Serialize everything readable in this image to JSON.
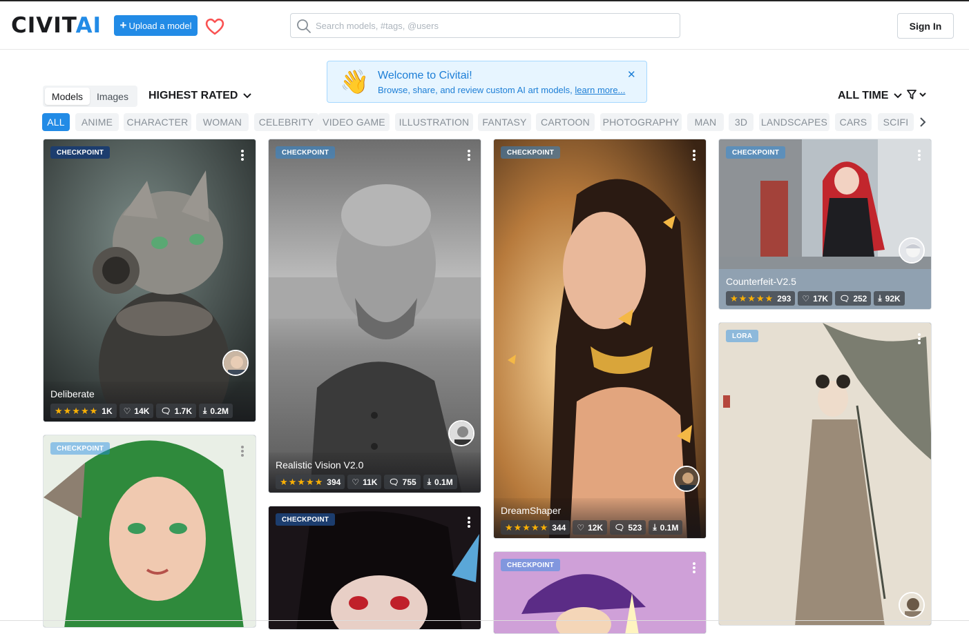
{
  "header": {
    "logo_main": "CIVIT",
    "logo_accent": "AI",
    "upload_label": "Upload a model",
    "search_placeholder": "Search models, #tags, @users",
    "signin_label": "Sign In"
  },
  "welcome": {
    "title": "Welcome to Civitai!",
    "body": "Browse, share, and review custom AI art models,",
    "link": "learn more..."
  },
  "toolbar": {
    "tab_models": "Models",
    "tab_images": "Images",
    "sort_label": "HIGHEST RATED",
    "period_label": "ALL TIME"
  },
  "tags": [
    "ALL",
    "ANIME",
    "CHARACTER",
    "WOMAN",
    "CELEBRITY",
    "VIDEO GAME",
    "ILLUSTRATION",
    "FANTASY",
    "CARTOON",
    "PHOTOGRAPHY",
    "MAN",
    "3D",
    "LANDSCAPES",
    "CARS",
    "SCIFI"
  ],
  "cards": [
    {
      "type": "CHECKPOINT",
      "name": "Deliberate",
      "rating": "1K",
      "likes": "14K",
      "comments": "1.7K",
      "downloads": "0.2M"
    },
    {
      "type": "CHECKPOINT",
      "name": "Realistic Vision V2.0",
      "rating": "394",
      "likes": "11K",
      "comments": "755",
      "downloads": "0.1M"
    },
    {
      "type": "CHECKPOINT",
      "name": "DreamShaper",
      "rating": "344",
      "likes": "12K",
      "comments": "523",
      "downloads": "0.1M"
    },
    {
      "type": "CHECKPOINT",
      "name": "Counterfeit-V2.5",
      "rating": "293",
      "likes": "17K",
      "comments": "252",
      "downloads": "92K"
    },
    {
      "type": "CHECKPOINT"
    },
    {
      "type": "CHECKPOINT"
    },
    {
      "type": "CHECKPOINT"
    },
    {
      "type": "LORA"
    }
  ],
  "colors": {
    "accent": "#228be6",
    "star": "#fab005",
    "badge": "#1c3d6e"
  }
}
